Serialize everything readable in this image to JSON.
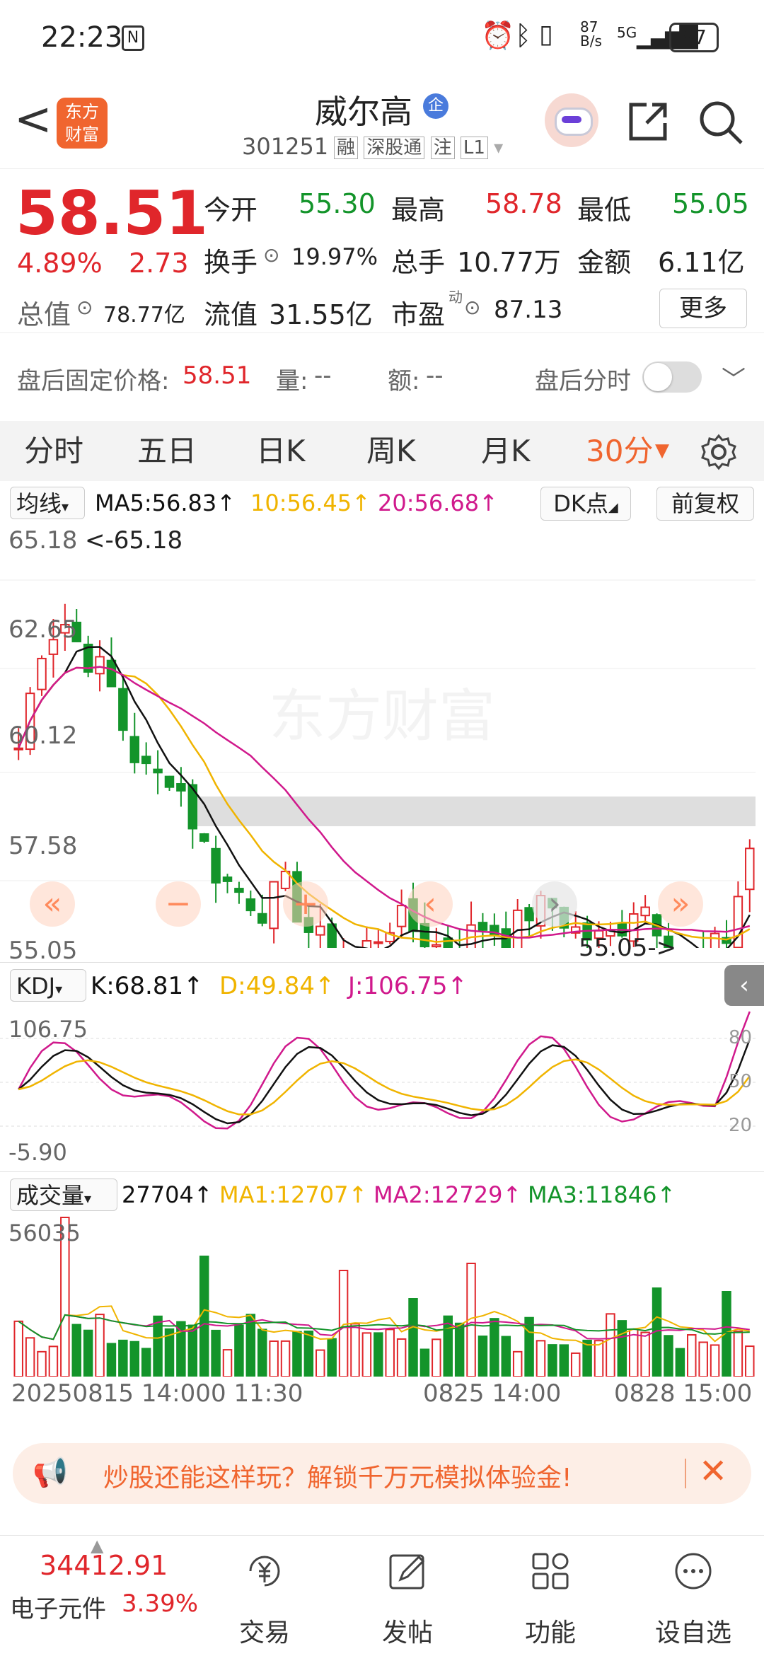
{
  "status_bar": {
    "time": "22:23",
    "net_speed": "87\nB/s",
    "signal": "5G",
    "battery": "87"
  },
  "header": {
    "back": "<",
    "app_badge_top": "东方",
    "app_badge_bottom": "财富",
    "stock_name": "威尔高",
    "name_badge": "企",
    "stock_code": "301251",
    "tags": [
      "融",
      "深股通",
      "注",
      "L1"
    ]
  },
  "quote": {
    "price": "58.51",
    "change_pct": "4.89%",
    "change_amt": "2.73",
    "open_label": "今开",
    "open": "55.30",
    "high_label": "最高",
    "high": "58.78",
    "low_label": "最低",
    "low": "55.05",
    "turnover_label": "换手",
    "turnover": "19.97%",
    "volume_label": "总手",
    "volume": "10.77万",
    "amount_label": "金额",
    "amount": "6.11亿",
    "mcap_label": "总值",
    "mcap": "78.77亿",
    "float_label": "流值",
    "float": "31.55亿",
    "pe_label": "市盈",
    "pe_super": "动",
    "pe": "87.13",
    "more_button": "更多"
  },
  "after_hours": {
    "label": "盘后固定价格:",
    "price": "58.51",
    "vol_label": "量:",
    "vol": "--",
    "amt_label": "额:",
    "amt": "--",
    "toggle_label": "盘后分时"
  },
  "tabs": [
    "分时",
    "五日",
    "日K",
    "周K",
    "月K",
    "30分"
  ],
  "active_tab": "30分",
  "main_chart": {
    "indicator": "均线",
    "ma5": "MA5:56.83↑",
    "ma10": "10:56.45↑",
    "ma20": "20:56.68↑",
    "dk_button": "DK点",
    "adjust_button": "前复权",
    "y_ticks": [
      "65.18",
      "62.65",
      "60.12",
      "57.58",
      "55.05"
    ],
    "high_marker": "<-65.18",
    "low_marker": "55.05->",
    "watermark": "东方财富"
  },
  "kdj_chart": {
    "indicator": "KDJ",
    "k": "K:68.81↑",
    "d": "D:49.84↑",
    "j": "J:106.75↑",
    "y_top": "106.75",
    "y_bottom": "-5.90",
    "levels": [
      "80",
      "50",
      "20"
    ]
  },
  "vol_chart": {
    "indicator": "成交量",
    "vol": "27704↑",
    "ma1": "MA1:12707↑",
    "ma2": "MA2:12729↑",
    "ma3": "MA3:11846↑",
    "y_top": "56035",
    "x_labels": [
      "20250815 14:00",
      "0 11:30",
      "0825 14:00",
      "0828 15:00"
    ]
  },
  "chart_data": {
    "type": "candlestick",
    "y_range": [
      55.05,
      65.18
    ],
    "high": 65.18,
    "low": 55.05,
    "ma_last": {
      "MA5": 56.83,
      "MA10": 56.45,
      "MA20": 56.68
    },
    "kdj_last": {
      "K": 68.81,
      "D": 49.84,
      "J": 106.75
    },
    "kdj_range": [
      -5.9,
      106.75
    ],
    "volume_last": 27704,
    "volume_max": 56035,
    "volume_ma": {
      "MA1": 12707,
      "MA2": 12729,
      "MA3": 11846
    }
  },
  "banner": {
    "text": "炒股还能这样玩？解锁千万元模拟体验金!"
  },
  "bottom_bar": {
    "index_value": "34412.91",
    "index_name": "电子元件",
    "index_change": "3.39%",
    "items": [
      "交易",
      "发帖",
      "功能",
      "设自选"
    ]
  },
  "colors": {
    "up": "#e0262b",
    "down": "#13942a",
    "ma5": "#111111",
    "ma10": "#f0b400",
    "ma20": "#d0198c",
    "accent": "#f0652f"
  }
}
